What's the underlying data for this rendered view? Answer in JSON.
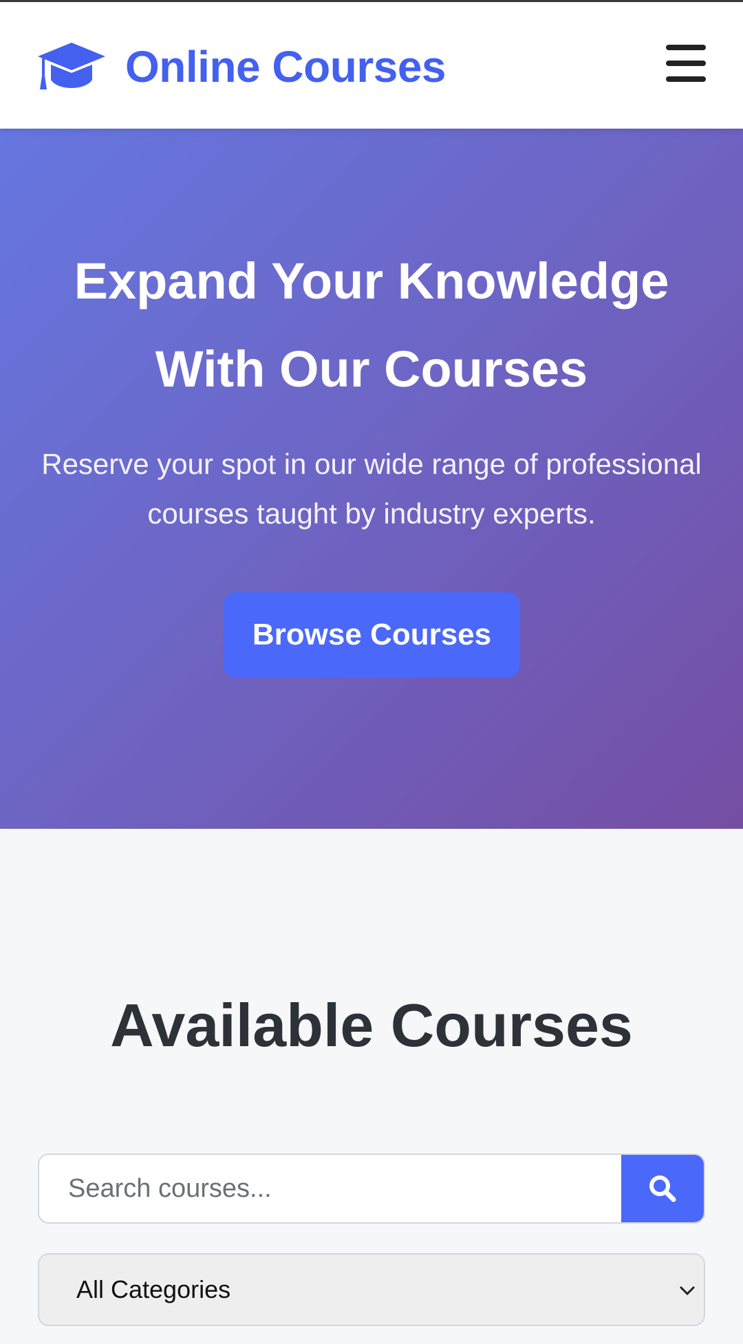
{
  "header": {
    "brand_name": "Online Courses",
    "brand_icon": "graduation-cap-icon",
    "menu_icon": "hamburger-menu-icon"
  },
  "hero": {
    "title": "Expand Your Knowledge With Our Courses",
    "subtitle": "Reserve your spot in our wide range of professional courses taught by industry experts.",
    "cta_label": "Browse Courses"
  },
  "courses": {
    "section_title": "Available Courses",
    "search": {
      "placeholder": "Search courses...",
      "value": "",
      "button_icon": "search-icon"
    },
    "category_select": {
      "selected": "All Categories"
    }
  },
  "colors": {
    "brand": "#4361ee",
    "button": "#4a68fa",
    "hero_gradient_start": "#6577e0",
    "hero_gradient_end": "#754ea3",
    "heading": "#2d3239",
    "page_background": "#f6f7f9"
  }
}
